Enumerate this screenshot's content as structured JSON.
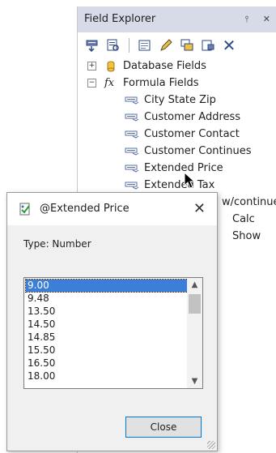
{
  "field_explorer": {
    "title": "Field Explorer",
    "pin_glyph": "⫯",
    "close_glyph": "✕",
    "toolbar_close_glyph": "✕",
    "tree": {
      "database_fields": "Database Fields",
      "formula_fields": "Formula Fields",
      "formula_items": [
        "City State Zip",
        "Customer Address",
        "Customer Contact",
        "Customer Continues",
        "Extended Price",
        "Extended Tax"
      ],
      "partial_items": [
        "w/continued",
        "Calc",
        "Show"
      ]
    }
  },
  "dialog": {
    "title": "@Extended Price",
    "close_glyph": "✕",
    "type_label": "Type: Number",
    "values": [
      "9.00",
      "9.48",
      "13.50",
      "14.50",
      "14.85",
      "15.50",
      "16.50",
      "18.00"
    ],
    "selected_index": 0,
    "close_button": "Close"
  },
  "colors": {
    "title_bar": "#d7dbe8",
    "selection": "#3c7fd9",
    "accent_blue": "#2c4a85"
  }
}
